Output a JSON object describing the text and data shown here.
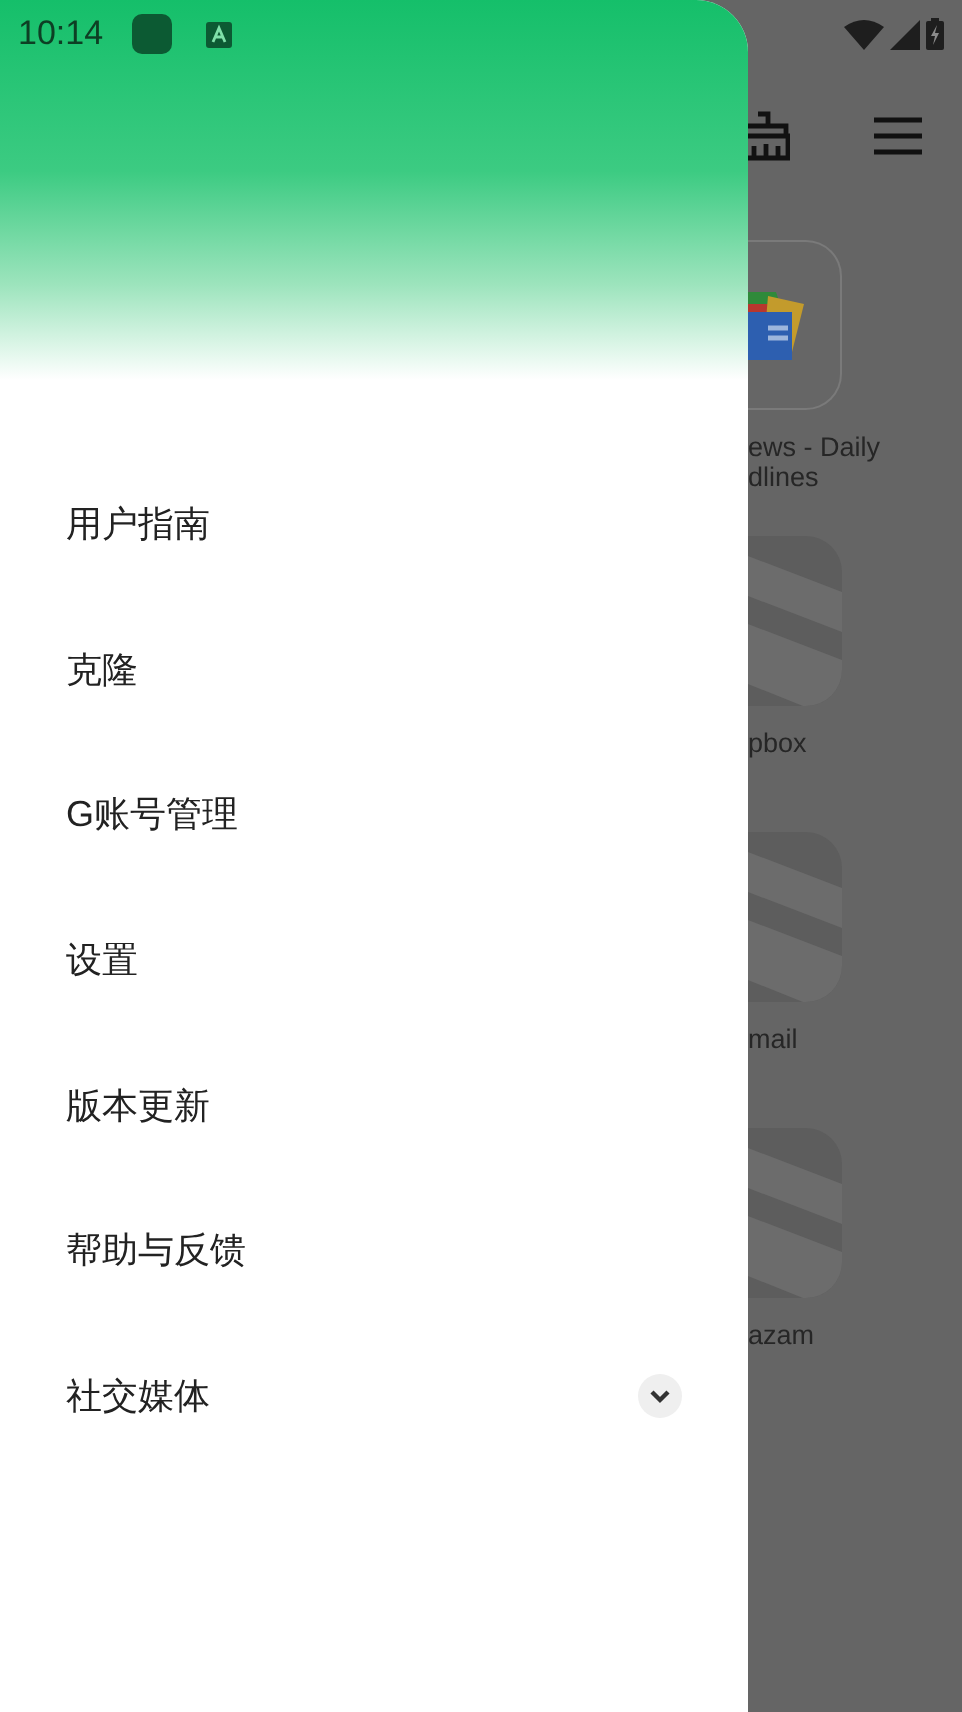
{
  "status_bar": {
    "time": "10:14"
  },
  "drawer": {
    "items": [
      {
        "label": "用户指南",
        "kind": "link"
      },
      {
        "label": "克隆",
        "kind": "link"
      },
      {
        "label": "G账号管理",
        "kind": "link"
      },
      {
        "label": "设置",
        "kind": "link"
      },
      {
        "label": "版本更新",
        "kind": "link"
      },
      {
        "label": "帮助与反馈",
        "kind": "link"
      },
      {
        "label": "社交媒体",
        "kind": "expandable",
        "expanded": false
      }
    ]
  },
  "apps": [
    {
      "lines": [
        "ews - Daily",
        "dlines"
      ],
      "kind": "news"
    },
    {
      "lines": [
        "pbox"
      ],
      "kind": "placeholder"
    },
    {
      "lines": [
        "mail"
      ],
      "kind": "placeholder"
    },
    {
      "lines": [
        "azam"
      ],
      "kind": "placeholder"
    }
  ]
}
